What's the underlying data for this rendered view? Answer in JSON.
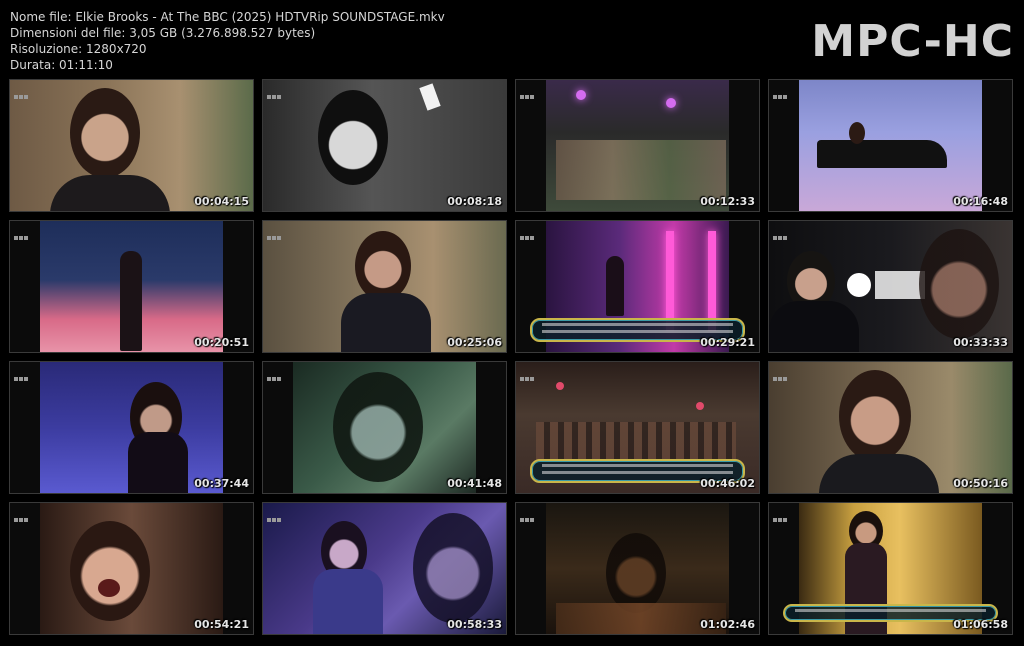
{
  "info": {
    "filename": "Nome file: Elkie Brooks - At The BBC (2025) HDTVRip SOUNDSTAGE.mkv",
    "filesize": "Dimensioni del file: 3,05 GB (3.276.898.527 bytes)",
    "resolution": "Risoluzione: 1280x720",
    "duration": "Durata: 01:11:10"
  },
  "brand": "MPC-HC",
  "thumbnails": [
    {
      "timestamp": "00:04:15"
    },
    {
      "timestamp": "00:08:18"
    },
    {
      "timestamp": "00:12:33"
    },
    {
      "timestamp": "00:16:48"
    },
    {
      "timestamp": "00:20:51"
    },
    {
      "timestamp": "00:25:06"
    },
    {
      "timestamp": "00:29:21"
    },
    {
      "timestamp": "00:33:33"
    },
    {
      "timestamp": "00:37:44"
    },
    {
      "timestamp": "00:41:48"
    },
    {
      "timestamp": "00:46:02"
    },
    {
      "timestamp": "00:50:16"
    },
    {
      "timestamp": "00:54:21"
    },
    {
      "timestamp": "00:58:33"
    },
    {
      "timestamp": "01:02:46"
    },
    {
      "timestamp": "01:06:58"
    }
  ],
  "colors": {
    "background": "#000000",
    "text": "#d6d6d6",
    "thumb_border": "#3a3a3a",
    "subtitle_border": "#c9b64a"
  }
}
